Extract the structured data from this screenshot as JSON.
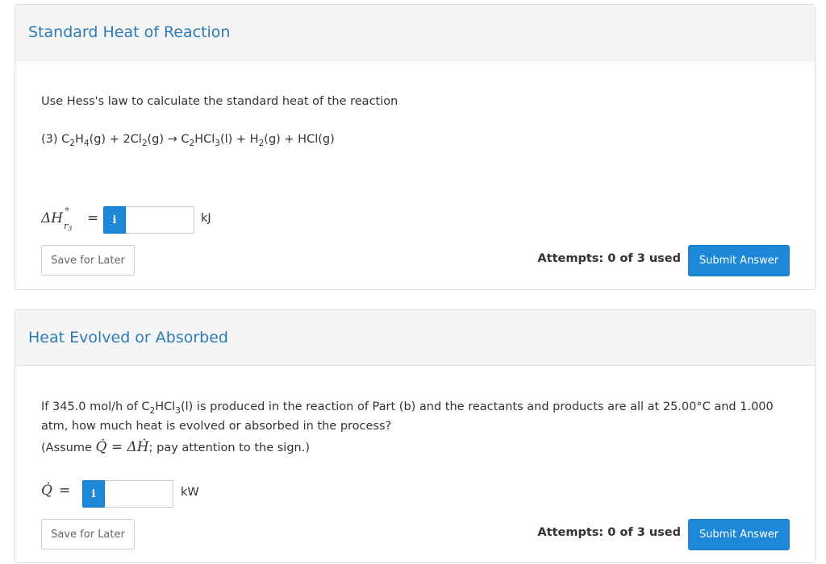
{
  "part1": {
    "title": "Standard Heat of Reaction",
    "instruction": "Use Hess's law to calculate the standard heat of the reaction",
    "equation": {
      "prefix": "(3) C",
      "s1": "2",
      "t1": "H",
      "s2": "4",
      "t2": "(g) + 2Cl",
      "s3": "2",
      "t3": "(g) → C",
      "s4": "2",
      "t4": "HCl",
      "s5": "3",
      "t5": "(l) + H",
      "s6": "2",
      "t6": "(g) + HCl(g)"
    },
    "label": {
      "delta": "ΔH",
      "deg": "°",
      "sub": "r",
      "subsub": "3",
      "eq": "="
    },
    "info_icon": "i",
    "input_value": "",
    "unit": "kJ",
    "save_label": "Save for Later",
    "attempts": "Attempts: 0 of 3 used",
    "submit_label": "Submit Answer"
  },
  "part2": {
    "title": "Heat Evolved or Absorbed",
    "question": {
      "a": "If 345.0 mol/h of C",
      "s1": "2",
      "b": "HCl",
      "s2": "3",
      "c": "(l) is produced in the reaction of Part (b) and the reactants and products are all at 25.00°C and 1.000",
      "line2": "atm, how much heat is evolved or absorbed in the process?"
    },
    "assume": {
      "a": "(Assume ",
      "q": "Q̇",
      "eq": " = ",
      "h": "ΔḢ",
      "b": "; pay attention to the sign.)"
    },
    "label": {
      "q": "Q̇",
      "eq": "="
    },
    "info_icon": "i",
    "input_value": "",
    "unit": "kW",
    "save_label": "Save for Later",
    "attempts": "Attempts: 0 of 3 used",
    "submit_label": "Submit Answer"
  },
  "colors": {
    "accent": "#1d87d8",
    "title": "#2d7bb6"
  }
}
